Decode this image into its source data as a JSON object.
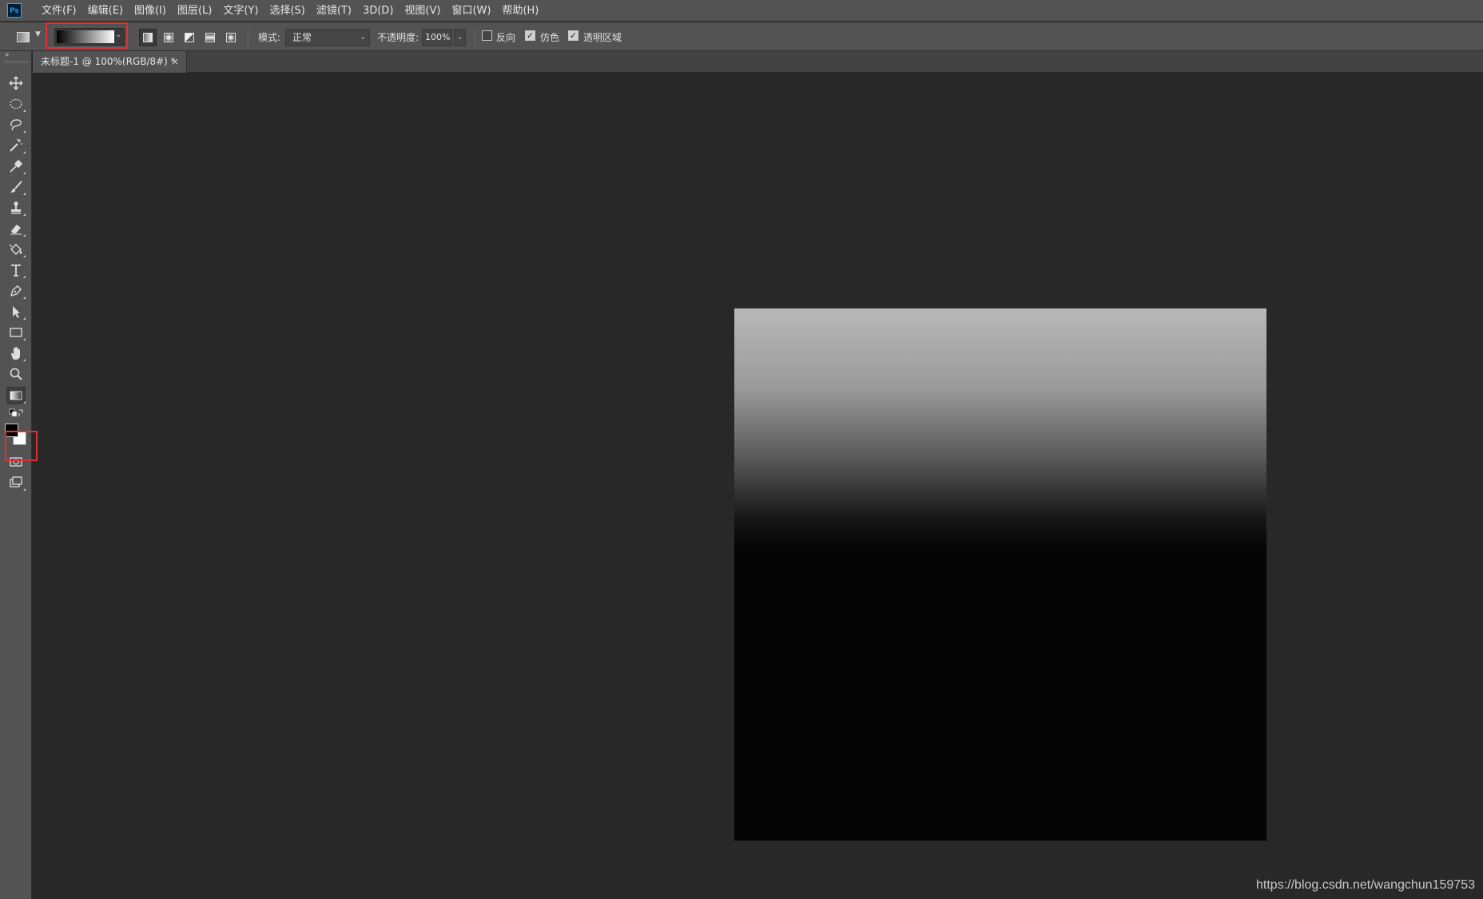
{
  "app": {
    "logo_text": "Ps"
  },
  "menu": [
    "文件(F)",
    "编辑(E)",
    "图像(I)",
    "图层(L)",
    "文字(Y)",
    "选择(S)",
    "滤镜(T)",
    "3D(D)",
    "视图(V)",
    "窗口(W)",
    "帮助(H)"
  ],
  "options": {
    "mode_label": "模式:",
    "mode_value": "正常",
    "opacity_label": "不透明度:",
    "opacity_value": "100%",
    "reverse_label": "反向",
    "reverse_checked": false,
    "dither_label": "仿色",
    "dither_checked": true,
    "transparency_label": "透明区域",
    "transparency_checked": true,
    "gradient_types": [
      "linear",
      "radial",
      "angle",
      "reflected",
      "diamond"
    ],
    "active_gradient_type": "linear"
  },
  "document": {
    "tab_title": "未标题-1 @ 100%(RGB/8#) *",
    "close_glyph": "×"
  },
  "tools": [
    "move-icon",
    "ellipse-marquee-icon",
    "lasso-icon",
    "magic-wand-icon",
    "eyedropper-icon",
    "brush-icon",
    "stamp-icon",
    "eraser-icon",
    "paint-bucket-icon",
    "type-icon",
    "pen-icon",
    "path-select-icon",
    "rectangle-icon",
    "hand-icon",
    "zoom-icon",
    "gradient-icon"
  ],
  "active_tool": "gradient-icon",
  "colors": {
    "foreground": "#000000",
    "background": "#ffffff",
    "highlight": "#e03030"
  },
  "watermark": "https://blog.csdn.net/wangchun159753"
}
